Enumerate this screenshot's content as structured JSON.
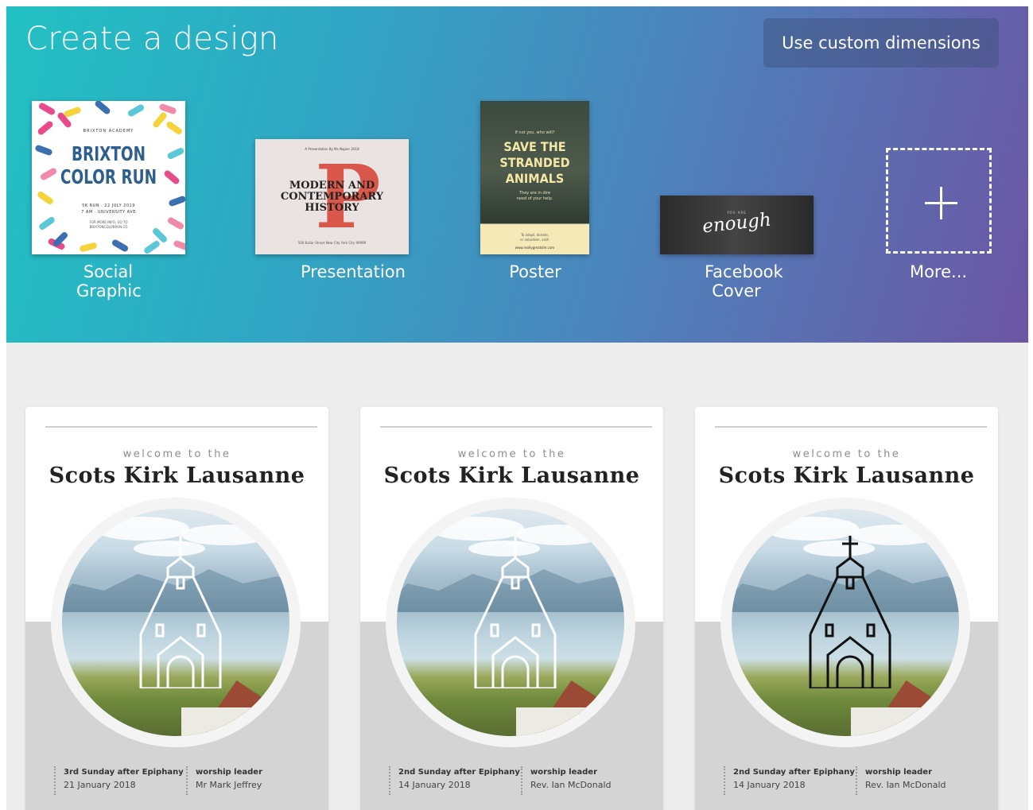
{
  "header": {
    "title": "Create a design",
    "custom_button": "Use custom dimensions"
  },
  "design_types": [
    {
      "label": "Social Graphic",
      "thumb": {
        "org": "BRIXTON ACADEMY",
        "title": "BRIXTON\nCOLOR RUN",
        "details": "5K RUN · 22 JULY 2019\n7 AM · UNIVERSITY AVE",
        "footer": "FOR MORE INFO, GO TO\nBRIXTONCOLORRUN.CO"
      }
    },
    {
      "label": "Presentation",
      "thumb": {
        "top": "A Presentation By Ms Napier 2018",
        "title": "MODERN AND\nCONTEMPORARY\nHISTORY",
        "bottom": "500 Kaliar Street New City York City 99999"
      }
    },
    {
      "label": "Poster",
      "thumb": {
        "top": "If not you, who will?",
        "title": "SAVE THE\nSTRANDED\nANIMALS",
        "sub": "They are in dire\nneed of your help.",
        "cta": "To adopt, donate,\nor volunteer, visit:",
        "url": "www.reallygreatsite.com"
      }
    },
    {
      "label": "Facebook Cover",
      "thumb": {
        "small": "YOU ARE",
        "script": "enough"
      }
    },
    {
      "label": "More..."
    }
  ],
  "templates": [
    {
      "welcome": "welcome to the",
      "name": "Scots Kirk Lausanne",
      "icon_style": "white",
      "occasion": "3rd Sunday after Epiphany",
      "date": "21 January 2018",
      "leader_label": "worship leader",
      "leader": "Mr Mark Jeffrey"
    },
    {
      "welcome": "welcome to the",
      "name": "Scots Kirk Lausanne",
      "icon_style": "white",
      "occasion": "2nd Sunday after Epiphany",
      "date": "14 January 2018",
      "leader_label": "worship leader",
      "leader": "Rev. Ian McDonald"
    },
    {
      "welcome": "welcome to the",
      "name": "Scots Kirk Lausanne",
      "icon_style": "black",
      "occasion": "2nd Sunday after Epiphany",
      "date": "14 January 2018",
      "leader_label": "worship leader",
      "leader": "Rev. Ian McDonald"
    }
  ],
  "colors": {
    "banner_start": "#22c1c3",
    "banner_end": "#6c55a4",
    "brixton_blue": "#2c5e8e",
    "presentation_accent": "#d9584b",
    "poster_yellow": "#f3e6a6"
  }
}
